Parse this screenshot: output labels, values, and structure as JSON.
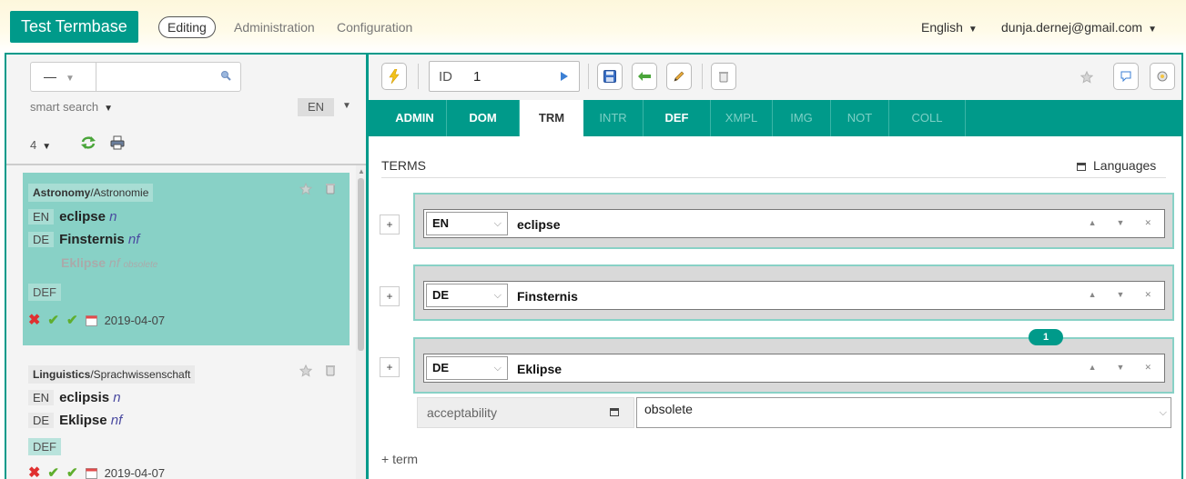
{
  "app": {
    "brand": "Test Termbase",
    "nav_editing": "Editing",
    "nav_administration": "Administration",
    "nav_configuration": "Configuration",
    "language": "English",
    "user": "dunja.dernej@gmail.com"
  },
  "left": {
    "search_select": "—",
    "search_value": "",
    "smart_search": "smart search",
    "lang_filter": "EN",
    "result_count": "4",
    "entries": [
      {
        "domain_en": "Astronomy",
        "domain_de": "/Astronomie",
        "terms": [
          {
            "lang": "EN",
            "term": "eclipse",
            "pos": "n"
          },
          {
            "lang": "DE",
            "term": "Finsternis",
            "pos": "nf"
          }
        ],
        "obsolete_term": {
          "term": "Eklipse",
          "pos": "nf",
          "note": "obsolete"
        },
        "def_label": "DEF",
        "date": "2019-04-07"
      },
      {
        "domain_en": "Linguistics",
        "domain_de": "/Sprachwissenschaft",
        "terms": [
          {
            "lang": "EN",
            "term": "eclipsis",
            "pos": "n"
          },
          {
            "lang": "DE",
            "term": "Eklipse",
            "pos": "nf"
          }
        ],
        "def_label": "DEF",
        "date": "2019-04-07"
      }
    ]
  },
  "right": {
    "id_label": "ID",
    "id_value": "1",
    "tabs": [
      {
        "label": "ADMIN",
        "state": "normal"
      },
      {
        "label": "DOM",
        "state": "normal"
      },
      {
        "label": "TRM",
        "state": "active"
      },
      {
        "label": "INTR",
        "state": "dim"
      },
      {
        "label": "DEF",
        "state": "normal"
      },
      {
        "label": "XMPL",
        "state": "dim"
      },
      {
        "label": "IMG",
        "state": "dim"
      },
      {
        "label": "NOT",
        "state": "dim"
      },
      {
        "label": "COLL",
        "state": "dim"
      }
    ],
    "terms_title": "TERMS",
    "languages_label": "Languages",
    "term_rows": [
      {
        "lang": "EN",
        "text": "eclipse"
      },
      {
        "lang": "DE",
        "text": "Finsternis"
      },
      {
        "lang": "DE",
        "text": "Eklipse"
      }
    ],
    "note_count": "1",
    "attribute": {
      "label": "acceptability",
      "value": "obsolete"
    },
    "add_term": "+ term"
  },
  "colors": {
    "accent": "#009a8a",
    "card_active": "#88d1c6",
    "error": "#e03030",
    "ok": "#5fae2e"
  }
}
